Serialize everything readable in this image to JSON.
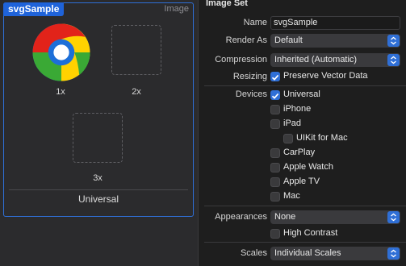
{
  "asset": {
    "name": "svgSample",
    "type_label": "Image",
    "slots": [
      {
        "label": "1x"
      },
      {
        "label": "2x"
      },
      {
        "label": "3x"
      }
    ],
    "group_label": "Universal"
  },
  "inspector": {
    "section_title": "Image Set",
    "name_label": "Name",
    "name_value": "svgSample",
    "render_as_label": "Render As",
    "render_as_value": "Default",
    "compression_label": "Compression",
    "compression_value": "Inherited (Automatic)",
    "resizing_label": "Resizing",
    "preserve_vector_label": "Preserve Vector Data",
    "preserve_vector_checked": true,
    "devices_label": "Devices",
    "devices": [
      {
        "label": "Universal",
        "checked": true
      },
      {
        "label": "iPhone",
        "checked": false
      },
      {
        "label": "iPad",
        "checked": false
      },
      {
        "label": "UIKit for Mac",
        "checked": false
      },
      {
        "label": "CarPlay",
        "checked": false
      },
      {
        "label": "Apple Watch",
        "checked": false
      },
      {
        "label": "Apple TV",
        "checked": false
      },
      {
        "label": "Mac",
        "checked": false
      }
    ],
    "appearances_label": "Appearances",
    "appearances_value": "None",
    "high_contrast_label": "High Contrast",
    "high_contrast_checked": false,
    "scales_label": "Scales",
    "scales_value": "Individual Scales"
  },
  "colors": {
    "accent": "#2f6fd6",
    "logo_red": "#e2231a",
    "logo_yellow": "#ffd200",
    "logo_green": "#3aa935",
    "logo_blue": "#1d6fd8"
  }
}
